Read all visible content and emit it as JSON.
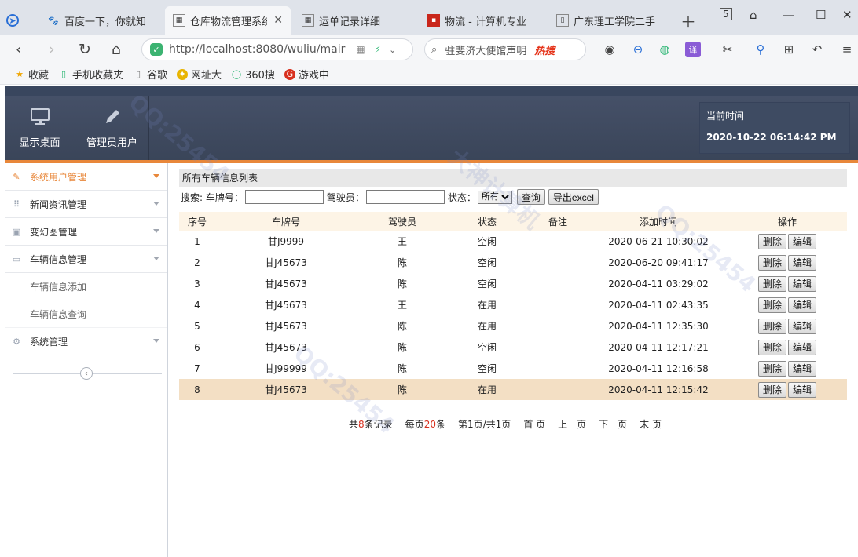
{
  "browser": {
    "tabs": [
      {
        "label": "百度一下，你就知"
      },
      {
        "label": "仓库物流管理系统"
      },
      {
        "label": "运单记录详细"
      },
      {
        "label": "物流 - 计算机专业"
      },
      {
        "label": "广东理工学院二手"
      }
    ],
    "url": "http://localhost:8080/wuliu/mair",
    "search_text": "驻斐济大使馆声明",
    "search_hot": "热搜",
    "bookmarks": [
      "收藏",
      "手机收藏夹",
      "谷歌",
      "网址大",
      "360搜",
      "游戏中"
    ]
  },
  "header": {
    "btn_desktop": "显示桌面",
    "btn_admin": "管理员用户",
    "time_label": "当前时间",
    "time_value": "2020-10-22 06:14:42 PM"
  },
  "sidebar": {
    "items": [
      {
        "label": "系统用户管理"
      },
      {
        "label": "新闻资讯管理"
      },
      {
        "label": "变幻图管理"
      },
      {
        "label": "车辆信息管理"
      }
    ],
    "sub_items": [
      {
        "label": "车辆信息添加"
      },
      {
        "label": "车辆信息查询"
      }
    ],
    "system": "系统管理"
  },
  "main": {
    "title": "所有车辆信息列表",
    "search": {
      "label": "搜索: 车牌号：",
      "driver_label": "驾驶员：",
      "status_label": "状态：",
      "status_selected": "所有",
      "query_btn": "查询",
      "export_btn": "导出excel"
    },
    "columns": [
      "序号",
      "车牌号",
      "驾驶员",
      "状态",
      "备注",
      "添加时间",
      "操作"
    ],
    "delete_label": "删除",
    "edit_label": "编辑",
    "rows": [
      {
        "no": "1",
        "plate": "甘J9999",
        "driver": "王",
        "status": "空闲",
        "note": "",
        "time": "2020-06-21 10:30:02"
      },
      {
        "no": "2",
        "plate": "甘J45673",
        "driver": "陈",
        "status": "空闲",
        "note": "",
        "time": "2020-06-20 09:41:17"
      },
      {
        "no": "3",
        "plate": "甘J45673",
        "driver": "陈",
        "status": "空闲",
        "note": "",
        "time": "2020-04-11 03:29:02"
      },
      {
        "no": "4",
        "plate": "甘J45673",
        "driver": "王",
        "status": "在用",
        "note": "",
        "time": "2020-04-11 02:43:35"
      },
      {
        "no": "5",
        "plate": "甘J45673",
        "driver": "陈",
        "status": "在用",
        "note": "",
        "time": "2020-04-11 12:35:30"
      },
      {
        "no": "6",
        "plate": "甘J45673",
        "driver": "陈",
        "status": "空闲",
        "note": "",
        "time": "2020-04-11 12:17:21"
      },
      {
        "no": "7",
        "plate": "甘J99999",
        "driver": "陈",
        "status": "空闲",
        "note": "",
        "time": "2020-04-11 12:16:58"
      },
      {
        "no": "8",
        "plate": "甘J45673",
        "driver": "陈",
        "status": "在用",
        "note": "",
        "time": "2020-04-11 12:15:42"
      }
    ],
    "pager": {
      "total_prefix": "共",
      "total": "8",
      "total_suffix": "条记录",
      "per_prefix": "每页",
      "per": "20",
      "per_suffix": "条",
      "page_info": "第1页/共1页",
      "first": "首 页",
      "prev": "上一页",
      "next": "下一页",
      "last": "末 页"
    }
  }
}
